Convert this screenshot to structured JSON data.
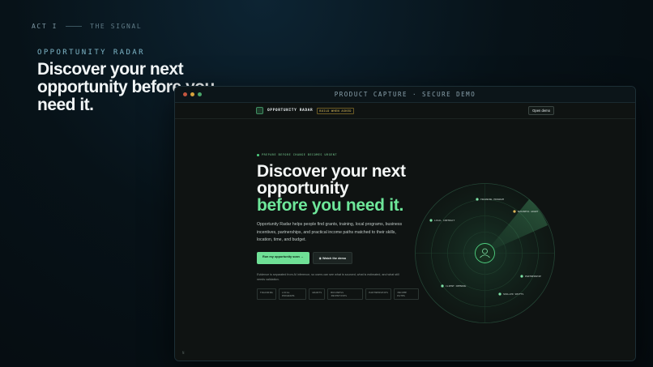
{
  "slide": {
    "act": "ACT I",
    "section": "THE SIGNAL",
    "eyebrow": "OPPORTUNITY RADAR",
    "headline": "Discover your next opportunity before you need it."
  },
  "capture": {
    "label": "PRODUCT CAPTURE · SECURE DEMO"
  },
  "app": {
    "brand": "OPPORTUNITY RADAR",
    "badge": "BUILD WHEN ASKED",
    "open_demo": "Open demo",
    "kicker": "PREPARE BEFORE CHANGE BECOMES URGENT",
    "title_line1": "Discover your next opportunity",
    "title_accent": "before you need it.",
    "description": "Opportunity Radar helps people find grants, training, local programs, business incentives, partnerships, and practical income paths matched to their skills, location, time, and budget.",
    "primary_cta": "Run my opportunity scan →",
    "secondary_cta": "Watch the demo",
    "evidence": "Evidence is separated from AI inference, so users can see what is sourced, what is estimated, and what still needs validation.",
    "tags": [
      "TRAINING",
      "LOCAL PROGRAMS",
      "GRANTS",
      "BUSINESS INCENTIVES",
      "PARTNERSHIPS",
      "INCOME PATHS"
    ],
    "corner": "N"
  },
  "radar": {
    "points": [
      {
        "label": "TRAINING PROGRAM",
        "color": "#7fe3a7"
      },
      {
        "label": "BUSINESS GRANT",
        "color": "#e0b85a"
      },
      {
        "label": "LOCAL CONTRACT",
        "color": "#7fe3a7"
      },
      {
        "label": "PARTNERSHIP",
        "color": "#7fe3a7"
      },
      {
        "label": "CLIENT OPENING",
        "color": "#7fe3a7"
      },
      {
        "label": "SKILLED SHIFTS",
        "color": "#7fe3a7"
      }
    ]
  }
}
